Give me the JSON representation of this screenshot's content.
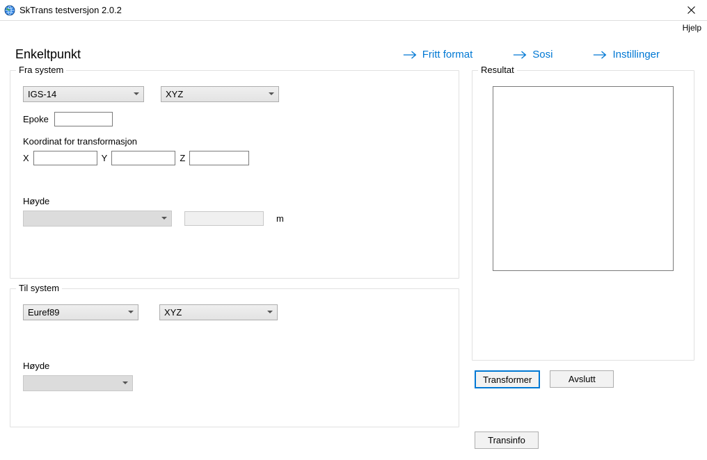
{
  "title": "SkTrans testversjon 2.0.2",
  "menu": {
    "help": "Hjelp"
  },
  "header": {
    "heading": "Enkeltpunkt",
    "links": {
      "fritt": "Fritt format",
      "sosi": "Sosi",
      "instillinger": "Instillinger"
    }
  },
  "fra": {
    "legend": "Fra system",
    "system": "IGS-14",
    "coordType": "XYZ",
    "epokeLabel": "Epoke",
    "koordLabel": "Koordinat for transformasjon",
    "xLabel": "X",
    "yLabel": "Y",
    "zLabel": "Z",
    "hoydeLabel": "Høyde",
    "hoydeUnit": "m"
  },
  "til": {
    "legend": "Til system",
    "system": "Euref89",
    "coordType": "XYZ",
    "hoydeLabel": "Høyde"
  },
  "resultat": {
    "legend": "Resultat"
  },
  "buttons": {
    "transformer": "Transformer",
    "avslutt": "Avslutt",
    "transinfo": "Transinfo"
  }
}
